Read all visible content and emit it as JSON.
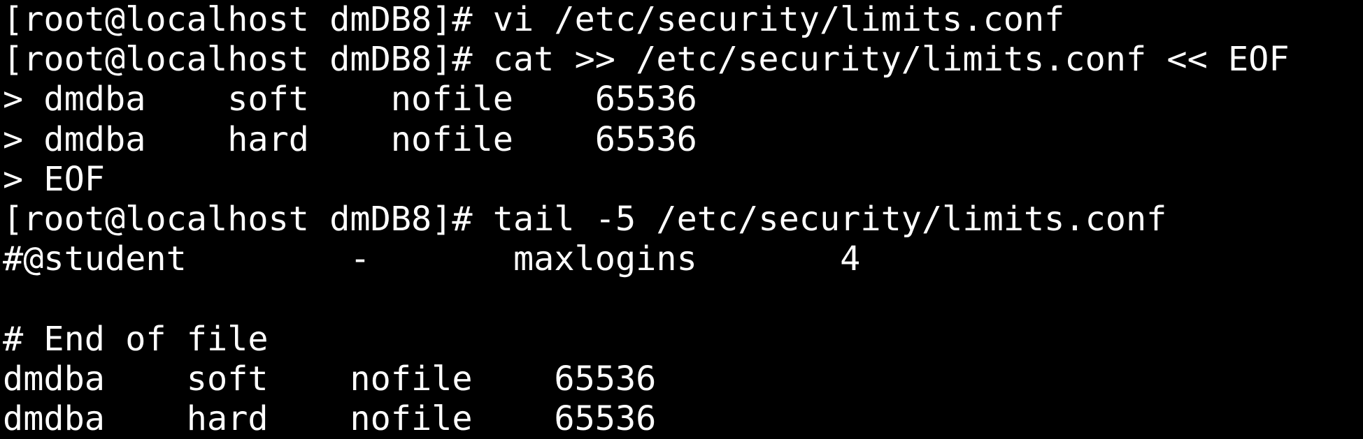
{
  "terminal": {
    "background_color": "#000000",
    "text_color": "#ffffff",
    "lines": [
      "[root@localhost dmDB8]# vi /etc/security/limits.conf",
      "[root@localhost dmDB8]# cat >> /etc/security/limits.conf << EOF",
      "> dmdba    soft    nofile    65536",
      "> dmdba    hard    nofile    65536",
      "> EOF",
      "[root@localhost dmDB8]# tail -5 /etc/security/limits.conf",
      "#@student        -       maxlogins       4",
      "",
      "# End of file",
      "dmdba    soft    nofile    65536",
      "dmdba    hard    nofile    65536"
    ]
  }
}
